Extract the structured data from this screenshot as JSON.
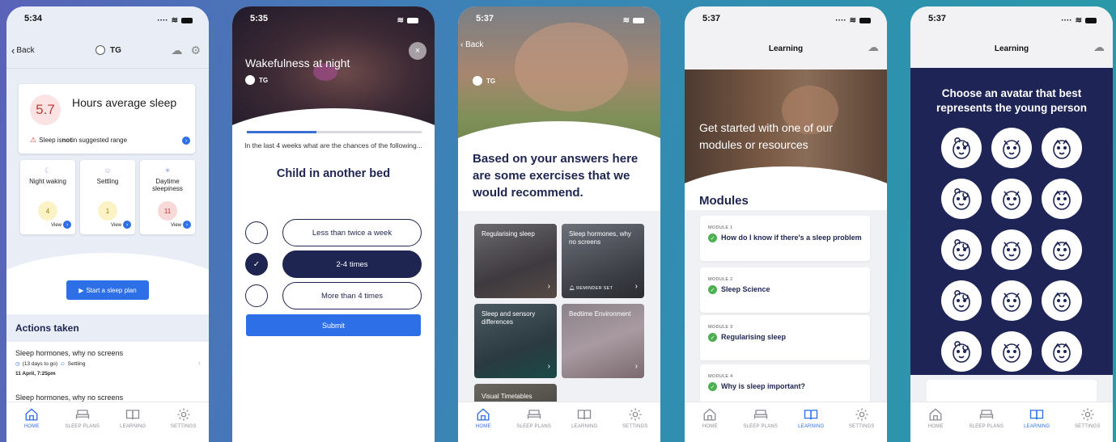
{
  "time": {
    "p1": "5:34",
    "p2": "5:35",
    "p3": "5:37",
    "p4": "5:37",
    "p5": "5:37"
  },
  "tabs": [
    {
      "label": "HOME",
      "icon": "home-icon"
    },
    {
      "label": "SLEEP PLANS",
      "icon": "bed-icon"
    },
    {
      "label": "LEARNING",
      "icon": "book-icon"
    },
    {
      "label": "SETTINGS",
      "icon": "gear-icon"
    }
  ],
  "home": {
    "back_label": "Back",
    "child_initials": "TG",
    "avg_value": "5.7",
    "avg_label": "Hours average sleep",
    "warning_pre": "Sleep is ",
    "warning_bold": "not",
    "warning_post": " in suggested range",
    "metrics": [
      {
        "title": "Night waking",
        "value": "4",
        "view": "View"
      },
      {
        "title": "Settling",
        "value": "1",
        "view": "View"
      },
      {
        "title": "Daytime sleepiness",
        "value": "11",
        "view": "View"
      }
    ],
    "start_plan_label": "Start a sleep plan",
    "actions_title": "Actions taken",
    "actions": [
      {
        "title": "Sleep hormones, why no screens",
        "countdown": "(13 days to go)",
        "tag": "Settling",
        "date": "11 April, 7:25pm"
      },
      {
        "title": "Sleep hormones, why no screens"
      }
    ]
  },
  "question": {
    "title": "Wakefulness at night",
    "child_initials": "TG",
    "close_label": "×",
    "progress": 0.4,
    "prompt": "In the last 4 weeks what are the chances of the following...",
    "item": "Child in another bed",
    "options": [
      {
        "label": "Less than twice a week",
        "selected": false
      },
      {
        "label": "2-4 times",
        "selected": true
      },
      {
        "label": "More than 4 times",
        "selected": false
      }
    ],
    "submit_label": "Submit"
  },
  "recommend": {
    "back_label": "Back",
    "child_initials": "TG",
    "intro": "Based on your answers here are some exercises that we would recommend.",
    "tiles": [
      {
        "title": "Regularising sleep"
      },
      {
        "title": "Sleep hormones, why no screens",
        "badge": "REMINDER SET"
      },
      {
        "title": "Sleep and sensory differences"
      },
      {
        "title": "Bedtime Environment"
      },
      {
        "title": "Visual Timetables"
      }
    ]
  },
  "learning": {
    "title": "Learning",
    "hero_text": "Get started with one of our modules or resources",
    "modules_title": "Modules",
    "modules": [
      {
        "label": "MODULE 1",
        "title": "How do I know if there's a sleep problem"
      },
      {
        "label": "MODULE 2",
        "title": "Sleep Science"
      },
      {
        "label": "MODULE 3",
        "title": "Regularising sleep"
      },
      {
        "label": "MODULE 4",
        "title": "Why is sleep important?"
      }
    ]
  },
  "avatar": {
    "title": "Learning",
    "heading": "Choose an avatar that best represents the young person",
    "avatars": [
      "bear-icon",
      "panda-icon",
      "gorilla-icon",
      "lion-icon",
      "tiger-icon",
      "walrus-icon",
      "snake-icon",
      "pig-icon",
      "rhino-icon",
      "cat-icon",
      "monkey-icon",
      "rabbit-icon",
      "cow-icon",
      "deer-icon",
      "fox-icon"
    ]
  },
  "colors": {
    "accent": "#2d6fe6",
    "navy": "#1e2550",
    "check": "#4caf50",
    "warn": "#c53b3b"
  }
}
